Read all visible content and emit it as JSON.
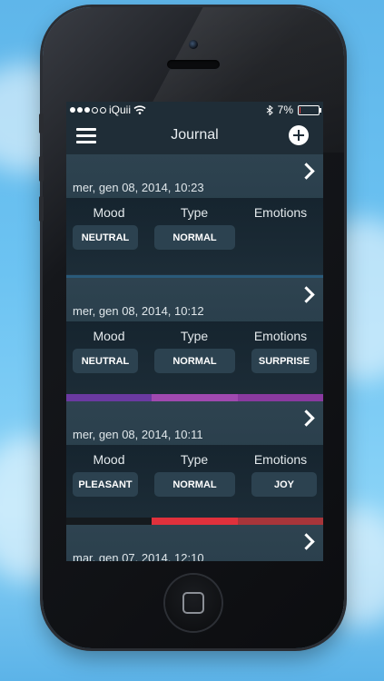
{
  "status_bar": {
    "carrier": "iQuii",
    "battery_percent": "7%",
    "battery_level": 0.07
  },
  "nav": {
    "title": "Journal"
  },
  "columns": {
    "mood": "Mood",
    "type": "Type",
    "emotions": "Emotions"
  },
  "entries": [
    {
      "date": "mer, gen 08, 2014, 10:23",
      "mood": "NEUTRAL",
      "type": "NORMAL",
      "emotion": "",
      "bar_colors": [
        "#2a5a7a",
        "#2a5a7a",
        "#2a5a7a"
      ]
    },
    {
      "date": "mer, gen 08, 2014, 10:12",
      "mood": "NEUTRAL",
      "type": "NORMAL",
      "emotion": "SURPRISE",
      "bar_colors": [
        "#6b3aa2",
        "#a049b0",
        "#8a3aa0"
      ]
    },
    {
      "date": "mer, gen 08, 2014, 10:11",
      "mood": "PLEASANT",
      "type": "NORMAL",
      "emotion": "JOY",
      "bar_colors": [
        "#151a1e",
        "#e0313c",
        "#a8353a"
      ]
    },
    {
      "date": "mar, gen 07, 2014, 12:10",
      "mood": "",
      "type": "",
      "emotion": "",
      "bar_colors": []
    }
  ],
  "colors": {
    "accent": "#1f2d37",
    "pill_bg": "#2c4250"
  }
}
